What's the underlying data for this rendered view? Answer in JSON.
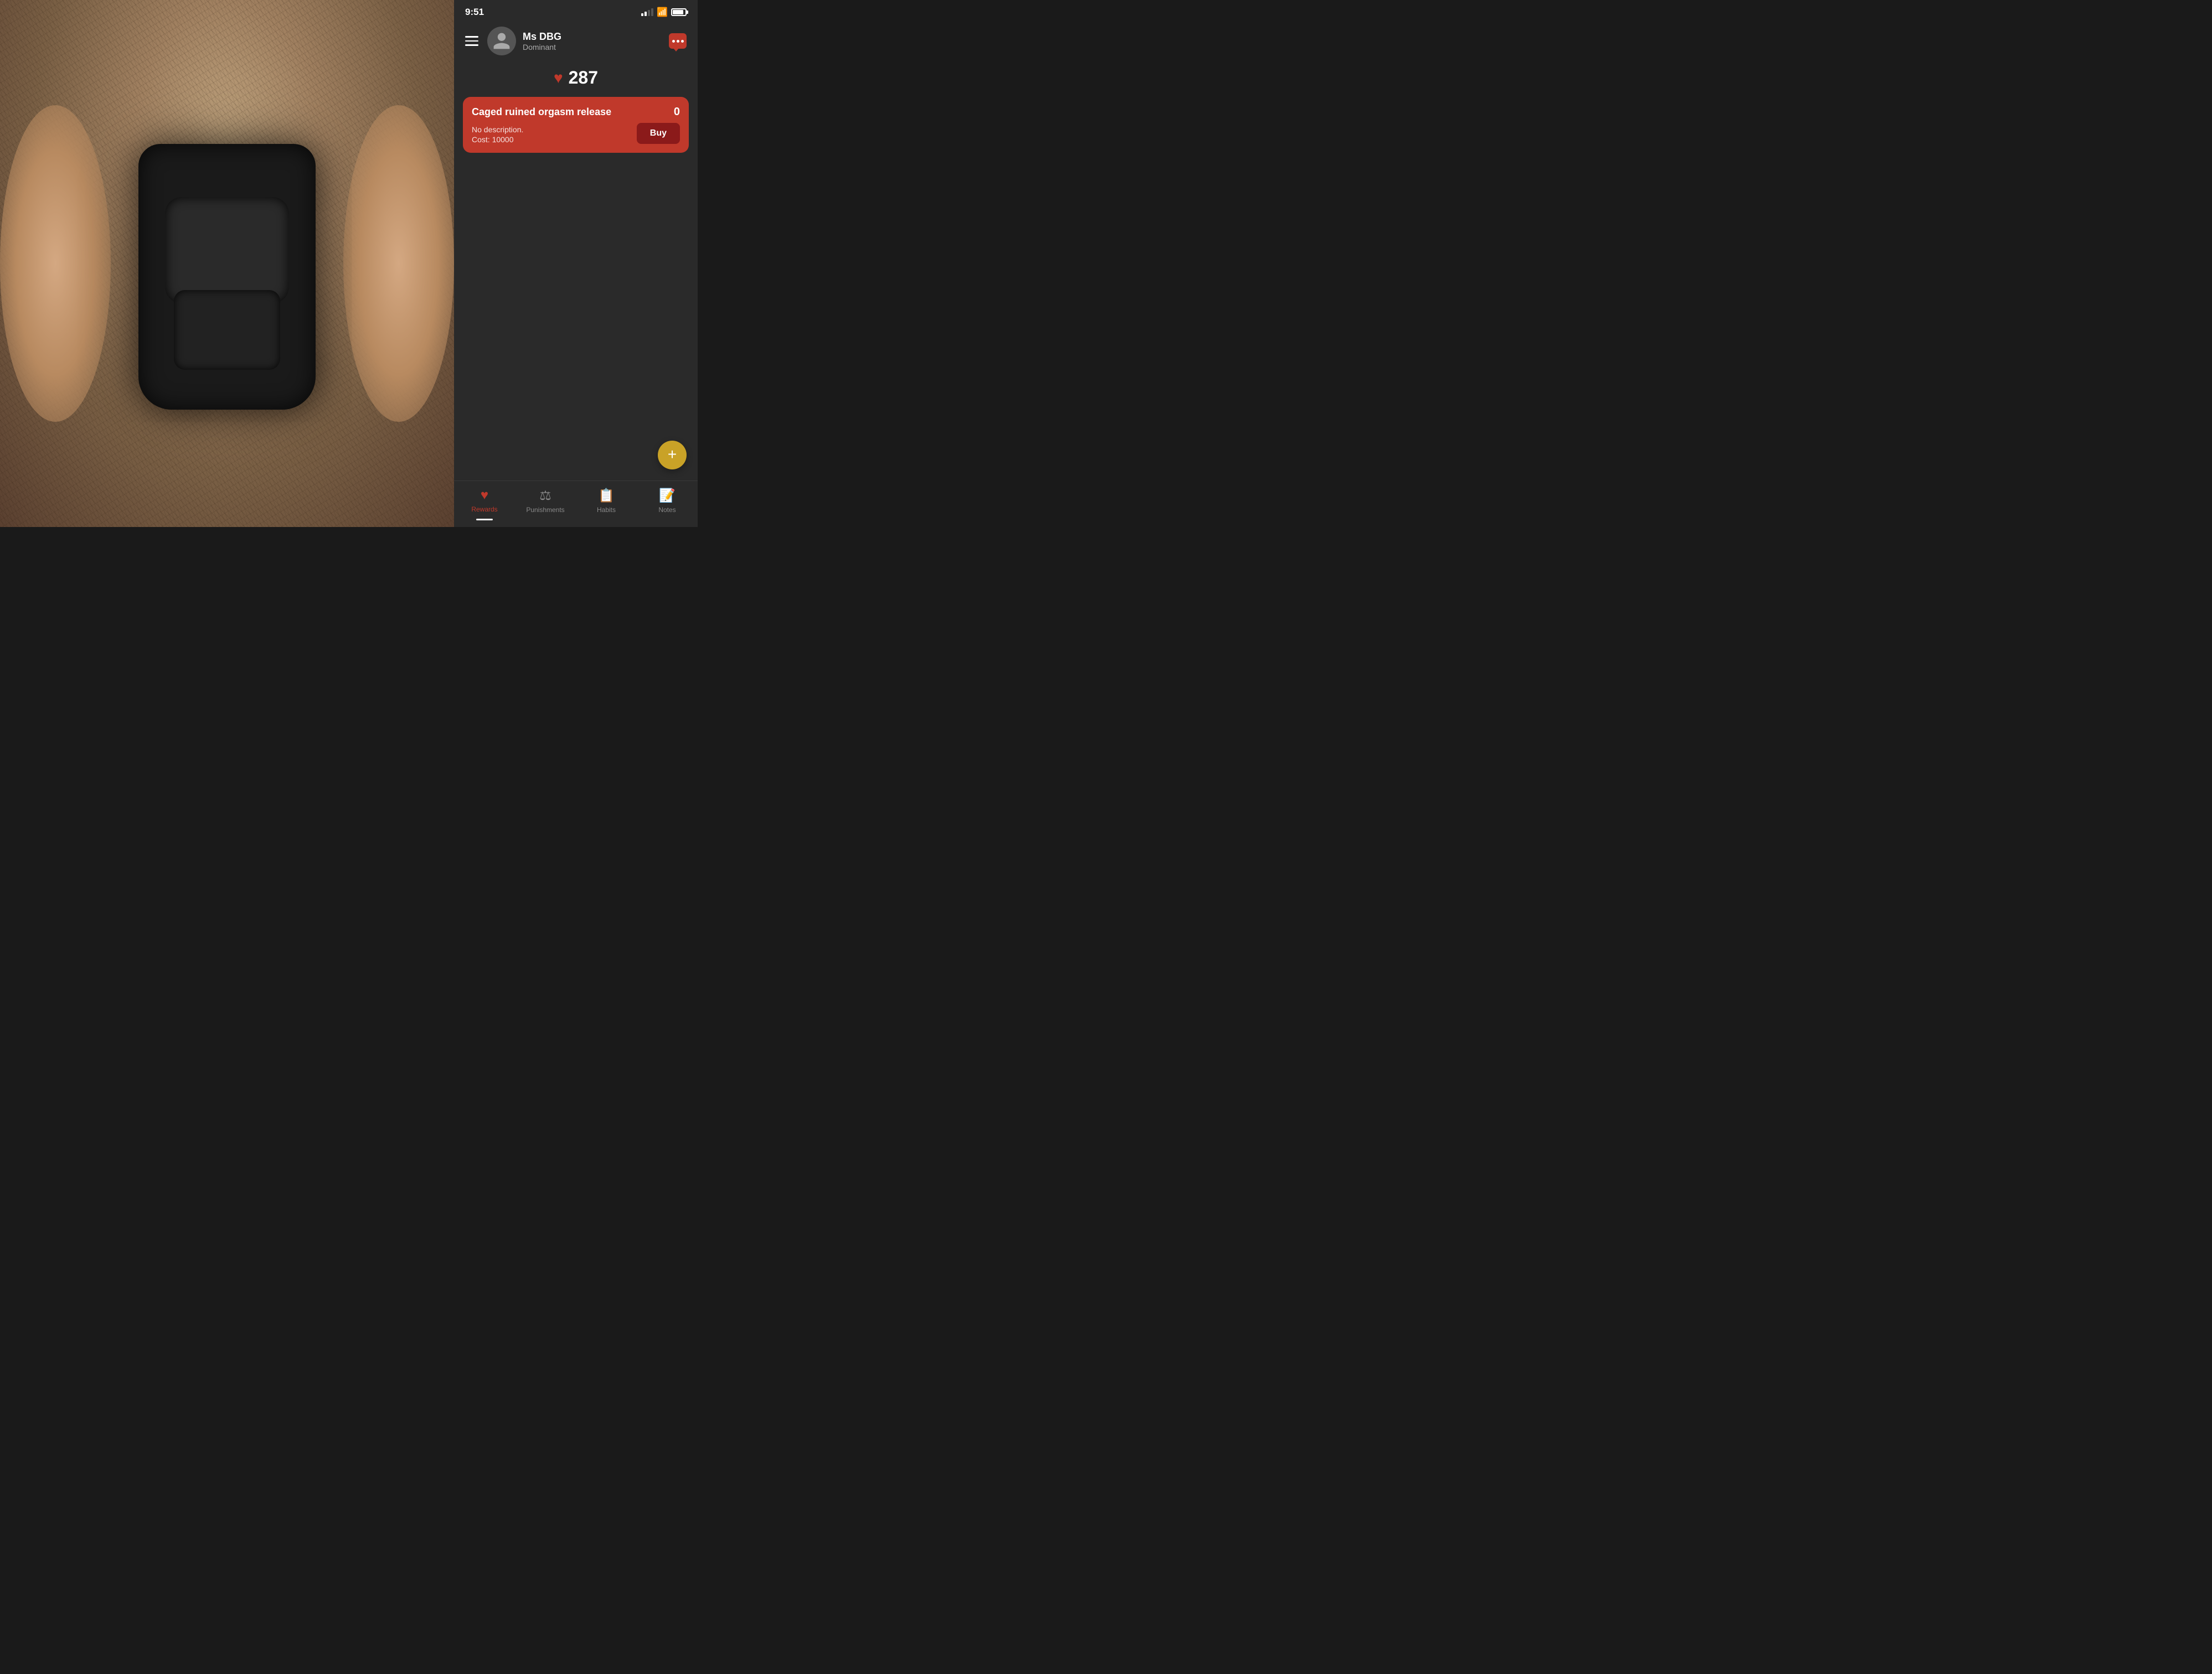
{
  "statusBar": {
    "time": "9:51",
    "moonIcon": "🌙"
  },
  "header": {
    "userName": "Ms DBG",
    "userRole": "Dominant",
    "menuLabel": "Menu",
    "chatLabel": "Chat"
  },
  "points": {
    "value": "287",
    "heartIcon": "♥"
  },
  "rewardCard": {
    "title": "Caged ruined orgasm release",
    "count": "0",
    "description": "No description.",
    "cost": "Cost: 10000",
    "buyLabel": "Buy"
  },
  "fab": {
    "label": "+"
  },
  "bottomNav": {
    "items": [
      {
        "id": "rewards",
        "label": "Rewards",
        "active": true
      },
      {
        "id": "punishments",
        "label": "Punishments",
        "active": false
      },
      {
        "id": "habits",
        "label": "Habits",
        "active": false
      },
      {
        "id": "notes",
        "label": "Notes",
        "active": false
      }
    ]
  }
}
